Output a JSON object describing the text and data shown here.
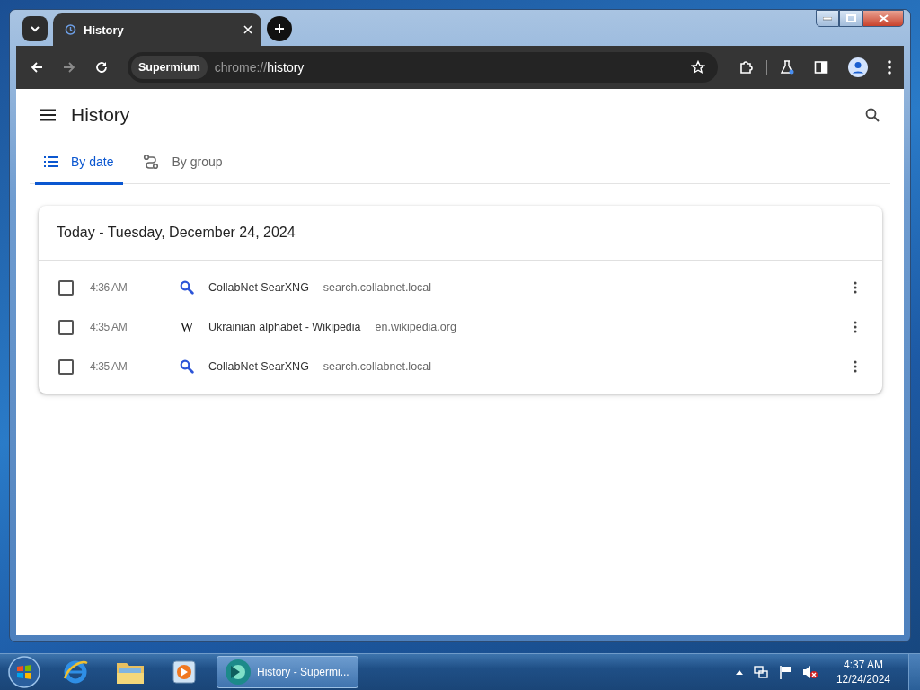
{
  "browser": {
    "tab": {
      "title": "History"
    },
    "omnibox": {
      "chip": "Supermium",
      "scheme": "chrome://",
      "path": "history"
    }
  },
  "page": {
    "title": "History",
    "tabs": [
      {
        "label": "By date",
        "selected": true,
        "kind": "list"
      },
      {
        "label": "By group",
        "selected": false,
        "kind": "group"
      }
    ],
    "day_heading": "Today - Tuesday, December 24, 2024",
    "entries": [
      {
        "time": "4:36 AM",
        "favicon": {
          "kind": "search"
        },
        "title": "CollabNet SearXNG",
        "domain": "search.collabnet.local",
        "checked": false
      },
      {
        "time": "4:35 AM",
        "favicon": {
          "kind": "letter",
          "glyph": "W"
        },
        "title": "Ukrainian alphabet - Wikipedia",
        "domain": "en.wikipedia.org",
        "checked": false
      },
      {
        "time": "4:35 AM",
        "favicon": {
          "kind": "search"
        },
        "title": "CollabNet SearXNG",
        "domain": "search.collabnet.local",
        "checked": false
      }
    ]
  },
  "taskbar": {
    "task": "History - Supermi...",
    "clock": {
      "time": "4:37 AM",
      "date": "12/24/2024"
    }
  }
}
